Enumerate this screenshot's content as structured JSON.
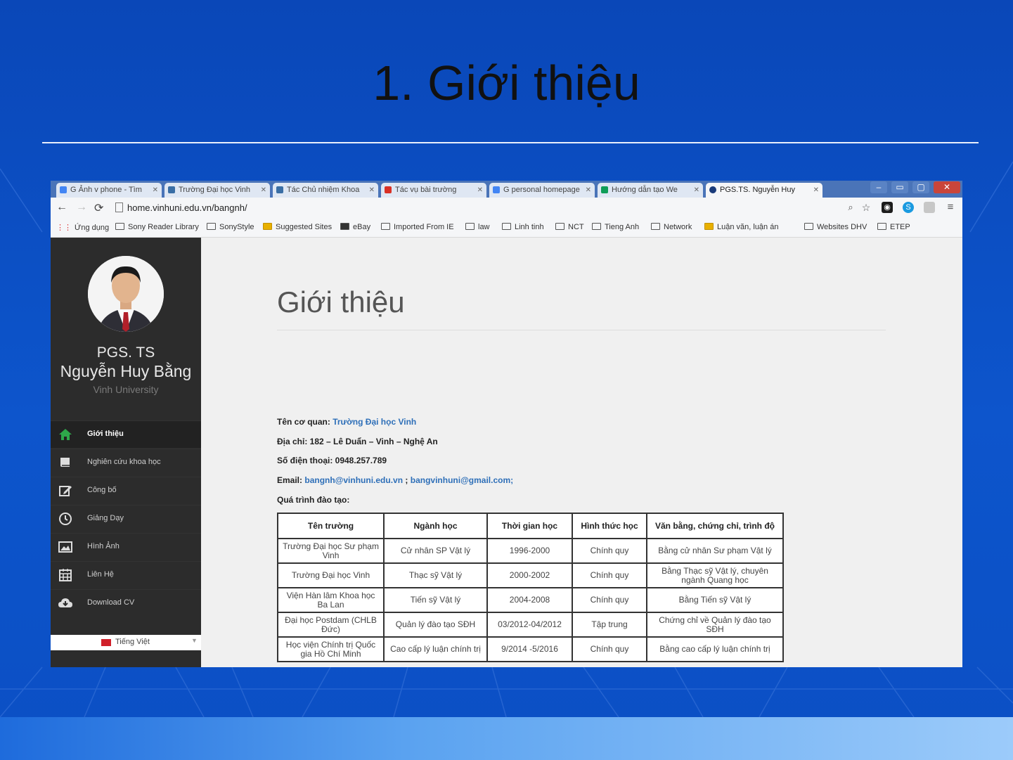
{
  "slide": {
    "title": "1. Giới thiệu"
  },
  "browser": {
    "tabs": [
      "G Ảnh v phone - Tìm",
      "Trường Đại học Vinh",
      "Tác Chủ nhiệm Khoa",
      "Tác vụ bài trường",
      "G personal homepage",
      "Hướng dẫn tạo We",
      "PGS.TS. Nguyễn Huy"
    ],
    "url": "home.vinhuni.edu.vn/bangnh/",
    "bookmarks": [
      "Ứng dụng",
      "Sony Reader Library",
      "SonyStyle",
      "Suggested Sites",
      "eBay",
      "Imported From IE",
      "law",
      "Linh tinh",
      "NCT",
      "Tieng Anh",
      "Network",
      "Luận văn, luận án",
      "Websites DHV",
      "ETEP"
    ]
  },
  "sidebar": {
    "title": "PGS. TS",
    "name": "Nguyễn Huy Bằng",
    "subtitle": "Vinh University",
    "menu": [
      {
        "label": "Giới thiệu",
        "icon": "home-icon",
        "active": true
      },
      {
        "label": "Nghiên cứu khoa học",
        "icon": "book-icon"
      },
      {
        "label": "Công bố",
        "icon": "edit-icon"
      },
      {
        "label": "Giảng Dạy",
        "icon": "clock-icon"
      },
      {
        "label": "Hình Ảnh",
        "icon": "image-icon"
      },
      {
        "label": "Liên Hệ",
        "icon": "calendar-icon"
      },
      {
        "label": "Download CV",
        "icon": "cloud-download-icon"
      }
    ],
    "language": "Tiếng Việt"
  },
  "content": {
    "heading": "Giới thiệu",
    "org_label": "Tên cơ quan:",
    "org_value": "Trường Đại học Vinh",
    "address": "Địa chỉ: 182 – Lê Duẩn – Vinh – Nghệ An",
    "phone": "Số điện thoại: 0948.257.789",
    "email_label": "Email:",
    "email_1": "bangnh@vinhuni.edu.vn",
    "email_sep": ";",
    "email_2": "bangvinhuni@gmail.com;",
    "training_label": "Quá trình đào tạo:",
    "table": {
      "headers": [
        "Tên trường",
        "Ngành học",
        "Thời gian học",
        "Hình thức học",
        "Văn bằng, chứng chỉ, trình độ"
      ],
      "rows": [
        [
          "Trường Đại học Sư phạm Vinh",
          "Cử nhân SP Vật lý",
          "1996-2000",
          "Chính quy",
          "Bằng cử nhân Sư phạm Vật lý"
        ],
        [
          "Trường Đại học Vinh",
          "Thạc sỹ Vật lý",
          "2000-2002",
          "Chính quy",
          "Bằng Thạc sỹ Vật lý, chuyên ngành Quang học"
        ],
        [
          "Viện Hàn lâm Khoa học Ba Lan",
          "Tiến sỹ Vật lý",
          "2004-2008",
          "Chính quy",
          "Bằng Tiến sỹ Vật lý"
        ],
        [
          "Đại học Postdam (CHLB Đức)",
          "Quản lý đào tạo SĐH",
          "03/2012-04/2012",
          "Tập trung",
          "Chứng chỉ về Quản lý đào tạo SĐH"
        ],
        [
          "Học viện Chính trị Quốc gia Hồ Chí Minh",
          "Cao cấp lý luận chính trị",
          "9/2014 -5/2016",
          "Chính quy",
          "Bằng cao cấp lý luận chính trị"
        ]
      ]
    }
  }
}
